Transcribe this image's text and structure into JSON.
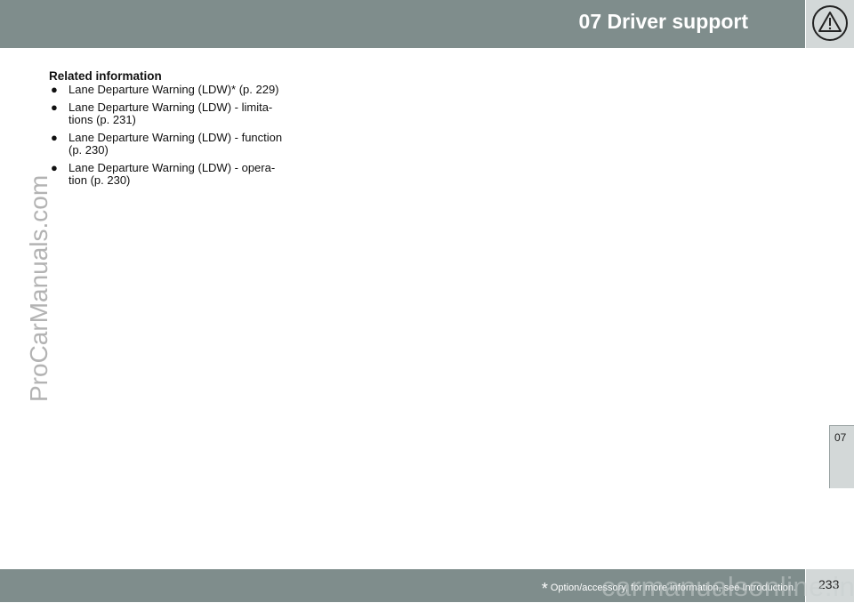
{
  "header": {
    "chapter_title": "07 Driver support",
    "warning_icon": "warning-triangle-icon"
  },
  "side_tab": {
    "label": "07"
  },
  "watermark_side": "ProCarManuals.com",
  "content": {
    "heading": "Related information",
    "items": [
      {
        "line1": "Lane Departure Warning (LDW)* (p. 229)",
        "line2": ""
      },
      {
        "line1": "Lane Departure Warning (LDW) - limita-",
        "line2": "tions (p. 231)"
      },
      {
        "line1": "Lane Departure Warning (LDW) - function",
        "line2": "(p. 230)"
      },
      {
        "line1": "Lane Departure Warning (LDW) - opera-",
        "line2": "tion (p. 230)"
      }
    ]
  },
  "footer": {
    "asterisk": "*",
    "note": "Option/accessory, for more information, see Introduction.",
    "page_number": "233",
    "watermark": "carmanualsonline.info"
  },
  "colors": {
    "header_bg": "#7f8d8c",
    "icon_bg": "#d3d8d8"
  }
}
